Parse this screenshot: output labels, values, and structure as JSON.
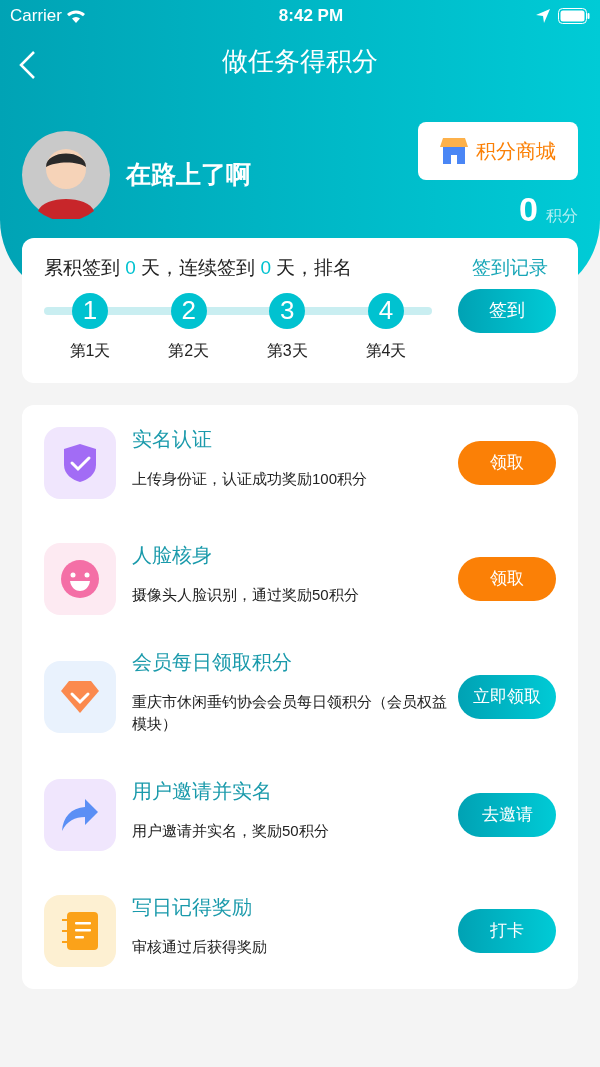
{
  "status_bar": {
    "carrier": "Carrier",
    "time": "8:42 PM"
  },
  "nav": {
    "title": "做任务得积分"
  },
  "profile": {
    "name": "在路上了啊",
    "mall_button": "积分商城",
    "points": "0",
    "points_unit": "积分"
  },
  "checkin": {
    "text_1": "累积签到",
    "total_days": "0",
    "text_2": "天，连续签到",
    "streak_days": "0",
    "text_3": "天，排名",
    "record_link": "签到记录",
    "button": "签到",
    "days": [
      {
        "number": "1",
        "label": "第1天"
      },
      {
        "number": "2",
        "label": "第2天"
      },
      {
        "number": "3",
        "label": "第3天"
      },
      {
        "number": "4",
        "label": "第4天"
      }
    ]
  },
  "tasks": [
    {
      "kind": "shield",
      "title": "实名认证",
      "description": "上传身份证，认证成功奖励100积分",
      "button": {
        "label": "领取",
        "kind": "claim"
      }
    },
    {
      "kind": "face",
      "title": "人脸核身",
      "description": "摄像头人脸识别，通过奖励50积分",
      "button": {
        "label": "领取",
        "kind": "claim"
      }
    },
    {
      "kind": "diamond",
      "title": "会员每日领取积分",
      "description": "重庆市休闲垂钓协会会员每日领积分（会员权益模块）",
      "button": {
        "label": "立即领取",
        "kind": "action"
      }
    },
    {
      "kind": "share",
      "title": "用户邀请并实名",
      "description": "用户邀请并实名，奖励50积分",
      "button": {
        "label": "去邀请",
        "kind": "action"
      }
    },
    {
      "kind": "notebook",
      "title": "写日记得奖励",
      "description": "审核通过后获得奖励",
      "button": {
        "label": "打卡",
        "kind": "action"
      }
    }
  ]
}
